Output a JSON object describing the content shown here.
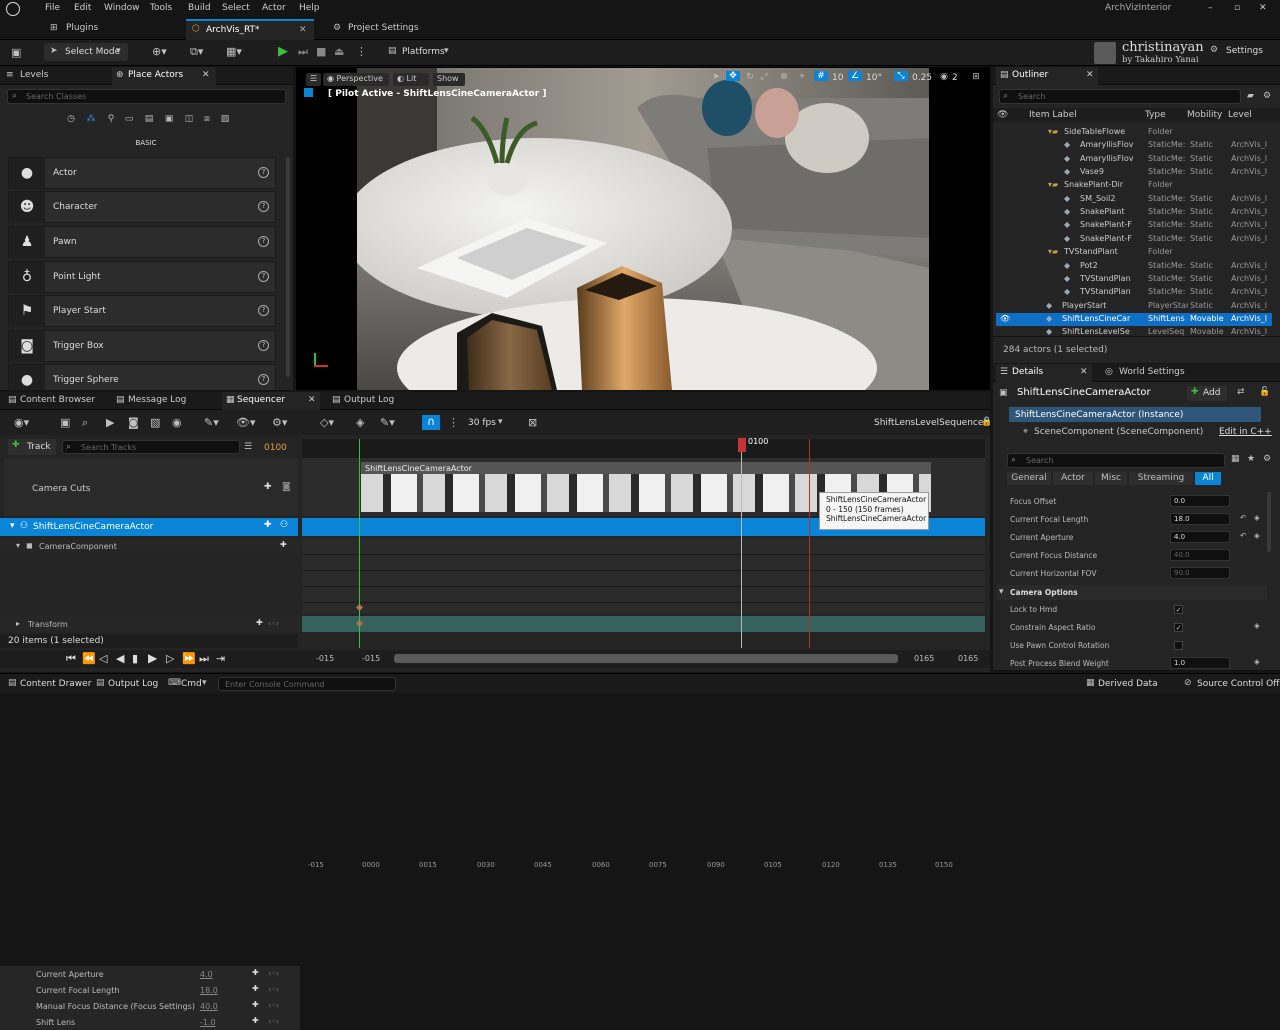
{
  "menu": [
    "File",
    "Edit",
    "Window",
    "Tools",
    "Build",
    "Select",
    "Actor",
    "Help"
  ],
  "project_name": "ArchVizInterior",
  "tabs": {
    "plugins": "Plugins",
    "level": "ArchVis_RT*",
    "project_settings": "Project Settings"
  },
  "toolbar": {
    "select_mode": "Select Mode",
    "platforms": "Platforms",
    "settings": "Settings"
  },
  "watermark": {
    "name": "christinayan",
    "by": "by Takahiro Yanai"
  },
  "left": {
    "tab_levels": "Levels",
    "tab_place_actors": "Place Actors",
    "search_placeholder": "Search Classes",
    "category": "BASIC",
    "actors": [
      {
        "label": "Actor",
        "icon": "sphere-icon"
      },
      {
        "label": "Character",
        "icon": "character-icon"
      },
      {
        "label": "Pawn",
        "icon": "pawn-icon"
      },
      {
        "label": "Point Light",
        "icon": "light-icon"
      },
      {
        "label": "Player Start",
        "icon": "player-start-icon"
      },
      {
        "label": "Trigger Box",
        "icon": "box-icon"
      },
      {
        "label": "Trigger Sphere",
        "icon": "sphere-icon"
      }
    ]
  },
  "viewport": {
    "perspective": "Perspective",
    "lit": "Lit",
    "show": "Show",
    "pilot": "[ Pilot Active - ShiftLensCineCameraActor ]",
    "grid": "10",
    "angle": "10°",
    "scale": "0.25",
    "cams": "2"
  },
  "outliner": {
    "tab": "Outliner",
    "search_placeholder": "Search",
    "col_label": "Item Label",
    "col_type": "Type",
    "col_mobility": "Mobility",
    "col_level": "Level",
    "rows": [
      {
        "label": "SideTableFlowe",
        "type": "Folder",
        "mobility": "",
        "level": ""
      },
      {
        "label": "AmaryllisFlov",
        "type": "StaticMe:",
        "mobility": "Static",
        "level": "ArchVis_l"
      },
      {
        "label": "AmaryllisFlov",
        "type": "StaticMe:",
        "mobility": "Static",
        "level": "ArchVis_l"
      },
      {
        "label": "Vase9",
        "type": "StaticMe:",
        "mobility": "Static",
        "level": "ArchVis_l"
      },
      {
        "label": "SnakePlant-Dir",
        "type": "Folder",
        "mobility": "",
        "level": ""
      },
      {
        "label": "SM_Soil2",
        "type": "StaticMe:",
        "mobility": "Static",
        "level": "ArchVis_l"
      },
      {
        "label": "SnakePlant",
        "type": "StaticMe:",
        "mobility": "Static",
        "level": "ArchVis_l"
      },
      {
        "label": "SnakePlant-F",
        "type": "StaticMe:",
        "mobility": "Static",
        "level": "ArchVis_l"
      },
      {
        "label": "SnakePlant-F",
        "type": "StaticMe:",
        "mobility": "Static",
        "level": "ArchVis_l"
      },
      {
        "label": "TVStandPlant",
        "type": "Folder",
        "mobility": "",
        "level": ""
      },
      {
        "label": "Pot2",
        "type": "StaticMe:",
        "mobility": "Static",
        "level": "ArchVis_l"
      },
      {
        "label": "TVStandPlan",
        "type": "StaticMe:",
        "mobility": "Static",
        "level": "ArchVis_l"
      },
      {
        "label": "TVStandPlan",
        "type": "StaticMe:",
        "mobility": "Static",
        "level": "ArchVis_l"
      },
      {
        "label": "PlayerStart",
        "type": "PlayerStar",
        "mobility": "Static",
        "level": "ArchVis_l"
      },
      {
        "label": "ShiftLensCineCar",
        "type": "ShiftLens",
        "mobility": "Movable",
        "level": "ArchVis_l"
      },
      {
        "label": "ShiftLensLevelSe",
        "type": "LevelSeq",
        "mobility": "Movable",
        "level": "ArchVis_l"
      }
    ],
    "count": "284 actors (1 selected)"
  },
  "details": {
    "tab_details": "Details",
    "tab_world": "World Settings",
    "actor": "ShiftLensCineCameraActor",
    "add": "Add",
    "instance": "ShiftLensCineCameraActor (Instance)",
    "component": "SceneComponent (SceneComponent)",
    "edit_cpp": "Edit in C++",
    "search_placeholder": "Search",
    "filters": [
      "General",
      "Actor",
      "Misc",
      "Streaming",
      "All"
    ],
    "props": [
      {
        "label": "Focus Offset",
        "value": "0.0"
      },
      {
        "label": "Current Focal Length",
        "value": "18.0"
      },
      {
        "label": "Current Aperture",
        "value": "4.0"
      },
      {
        "label": "Current Focus Distance",
        "value": "40.0"
      },
      {
        "label": "Current Horizontal FOV",
        "value": "90.0"
      }
    ],
    "section": "Camera Options",
    "options": [
      {
        "label": "Lock to Hmd",
        "value": "✓"
      },
      {
        "label": "Constrain Aspect Ratio",
        "value": "✓"
      },
      {
        "label": "Use Pawn Control Rotation",
        "value": ""
      },
      {
        "label": "Post Process Blend Weight",
        "value": "1.0"
      }
    ]
  },
  "bottom_tabs": {
    "content_browser": "Content Browser",
    "message_log": "Message Log",
    "sequencer": "Sequencer",
    "output_log": "Output Log"
  },
  "sequencer": {
    "fps": "30 fps",
    "sequence": "ShiftLensLevelSequence*",
    "track": "Track",
    "search_placeholder": "Search Tracks",
    "frame": "0100",
    "playhead": "0100",
    "ticks": [
      "-015",
      "0000",
      "0015",
      "0030",
      "0045",
      "0060",
      "0075",
      "0090",
      "0105",
      "0120",
      "0135",
      "0150"
    ],
    "tracks": {
      "camera_cuts": "Camera Cuts",
      "actor": "ShiftLensCineCameraActor",
      "component": "CameraComponent",
      "transform": "Transform"
    },
    "props": [
      {
        "label": "Current Aperture",
        "value": "4.0"
      },
      {
        "label": "Current Focal Length",
        "value": "18.0"
      },
      {
        "label": "Manual Focus Distance (Focus Settings)",
        "value": "40.0"
      },
      {
        "label": "Shift Lens",
        "value": "-1.0"
      }
    ],
    "clip_label": "ShiftLensCineCameraActor",
    "tooltip": [
      "ShiftLensCineCameraActor",
      "0 - 150 (150 frames)",
      "ShiftLensCineCameraActor"
    ],
    "items": "20 items (1 selected)",
    "range": {
      "start1": "-015",
      "start2": "-015",
      "end1": "0165",
      "end2": "0165"
    }
  },
  "statusbar": {
    "content_drawer": "Content Drawer",
    "output_log": "Output Log",
    "cmd": "Cmd",
    "console_placeholder": "Enter Console Command",
    "derived": "Derived Data",
    "source": "Source Control Off"
  },
  "colors": {
    "accent": "#0a84d6",
    "selection": "#0f6fc5",
    "play_green": "#3cbd3c",
    "playhead": "#c43434",
    "transform_track": "#35625c"
  }
}
